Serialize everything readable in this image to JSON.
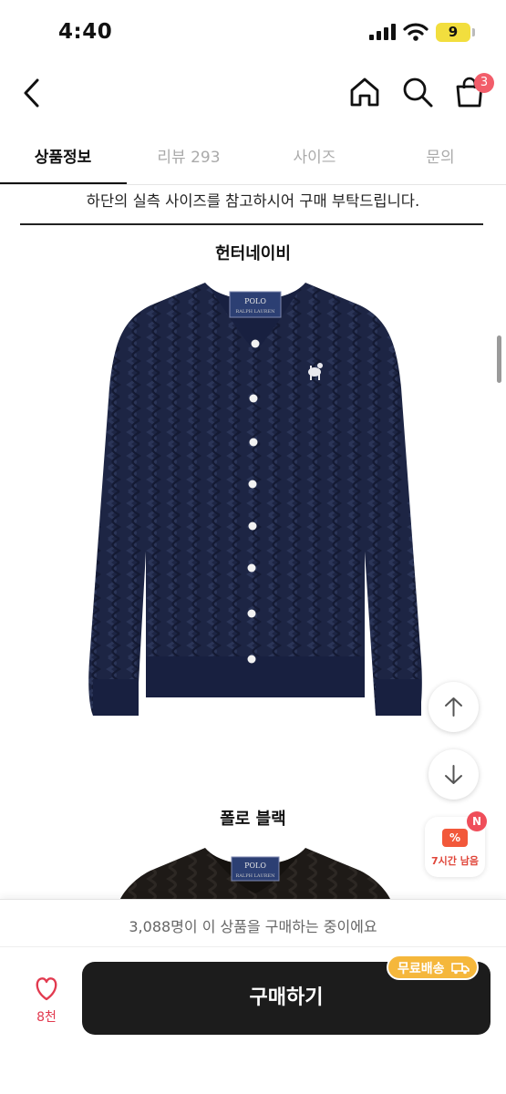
{
  "status_bar": {
    "time": "4:40",
    "battery": "9"
  },
  "header": {
    "cart_count": "3",
    "icons": [
      "back-chevron-icon",
      "home-icon",
      "search-icon",
      "shopping-bag-icon"
    ]
  },
  "tabs": [
    {
      "label": "상품정보",
      "active": true
    },
    {
      "label": "리뷰 293",
      "active": false
    },
    {
      "label": "사이즈",
      "active": false
    },
    {
      "label": "문의",
      "active": false
    }
  ],
  "content": {
    "notice": "하단의 실측 사이즈를 참고하시어 구매 부탁드립니다.",
    "products": [
      {
        "name": "헌터네이비",
        "color": "#1d2544"
      },
      {
        "name": "폴로 블랙",
        "color": "#1e1a17"
      }
    ],
    "label_text": "POLO",
    "label_subtext": "RALPH LAUREN"
  },
  "floating": {
    "coupon_badge": "N",
    "coupon_icon": "%",
    "coupon_label": "7시간 남음"
  },
  "bottom_bar": {
    "buyers_text": "3,088명이 이 상품을 구매하는 중이에요",
    "like_count": "8천",
    "buy_label": "구매하기",
    "shipping_badge": "무료배송"
  },
  "colors": {
    "accent_red": "#e23a4f",
    "buy_button": "#1c1c1c",
    "shipping_badge": "#f5b73b"
  }
}
